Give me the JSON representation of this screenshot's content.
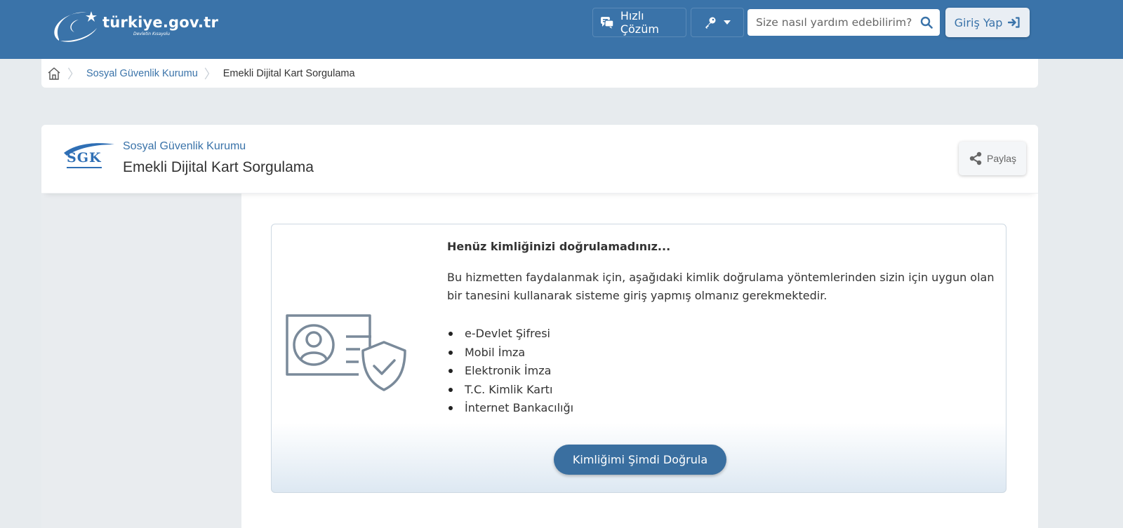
{
  "header": {
    "logo_text": "türkiye.gov.tr",
    "logo_tagline": "Devletin Kısayolu",
    "quick_solution_label": "Hızlı Çözüm",
    "search_placeholder": "Size nasıl yardım edebilirim?",
    "login_label": "Giriş Yap"
  },
  "breadcrumb": {
    "items": [
      "Sosyal Güvenlik Kurumu",
      "Emekli Dijital Kart Sorgulama"
    ]
  },
  "service": {
    "logo_text": "SGK",
    "organization": "Sosyal Güvenlik Kurumu",
    "title": "Emekli Dijital Kart Sorgulama",
    "share_label": "Paylaş"
  },
  "notice": {
    "title": "Henüz kimliğinizi doğrulamadınız...",
    "description": "Bu hizmetten faydalanmak için, aşağıdaki kimlik doğrulama yöntemlerinden sizin için uygun olan bir tanesini kullanarak sisteme giriş yapmış olmanız gerekmektedir.",
    "methods": [
      "e-Devlet Şifresi",
      "Mobil İmza",
      "Elektronik İmza",
      "T.C. Kimlik Kartı",
      "İnternet Bankacılığı"
    ],
    "verify_button": "Kimliğimi Şimdi Doğrula"
  },
  "colors": {
    "header_bg": "#3a73a9",
    "accent": "#3a73a9",
    "verify_button_bg": "#3a6fa0",
    "page_bg": "#e7ebee"
  },
  "icons": [
    "logo-swoosh-icon",
    "chat-icon",
    "key-icon",
    "caret-down-icon",
    "search-icon",
    "login-arrow-icon",
    "home-icon",
    "share-icon",
    "id-card-shield-icon"
  ]
}
